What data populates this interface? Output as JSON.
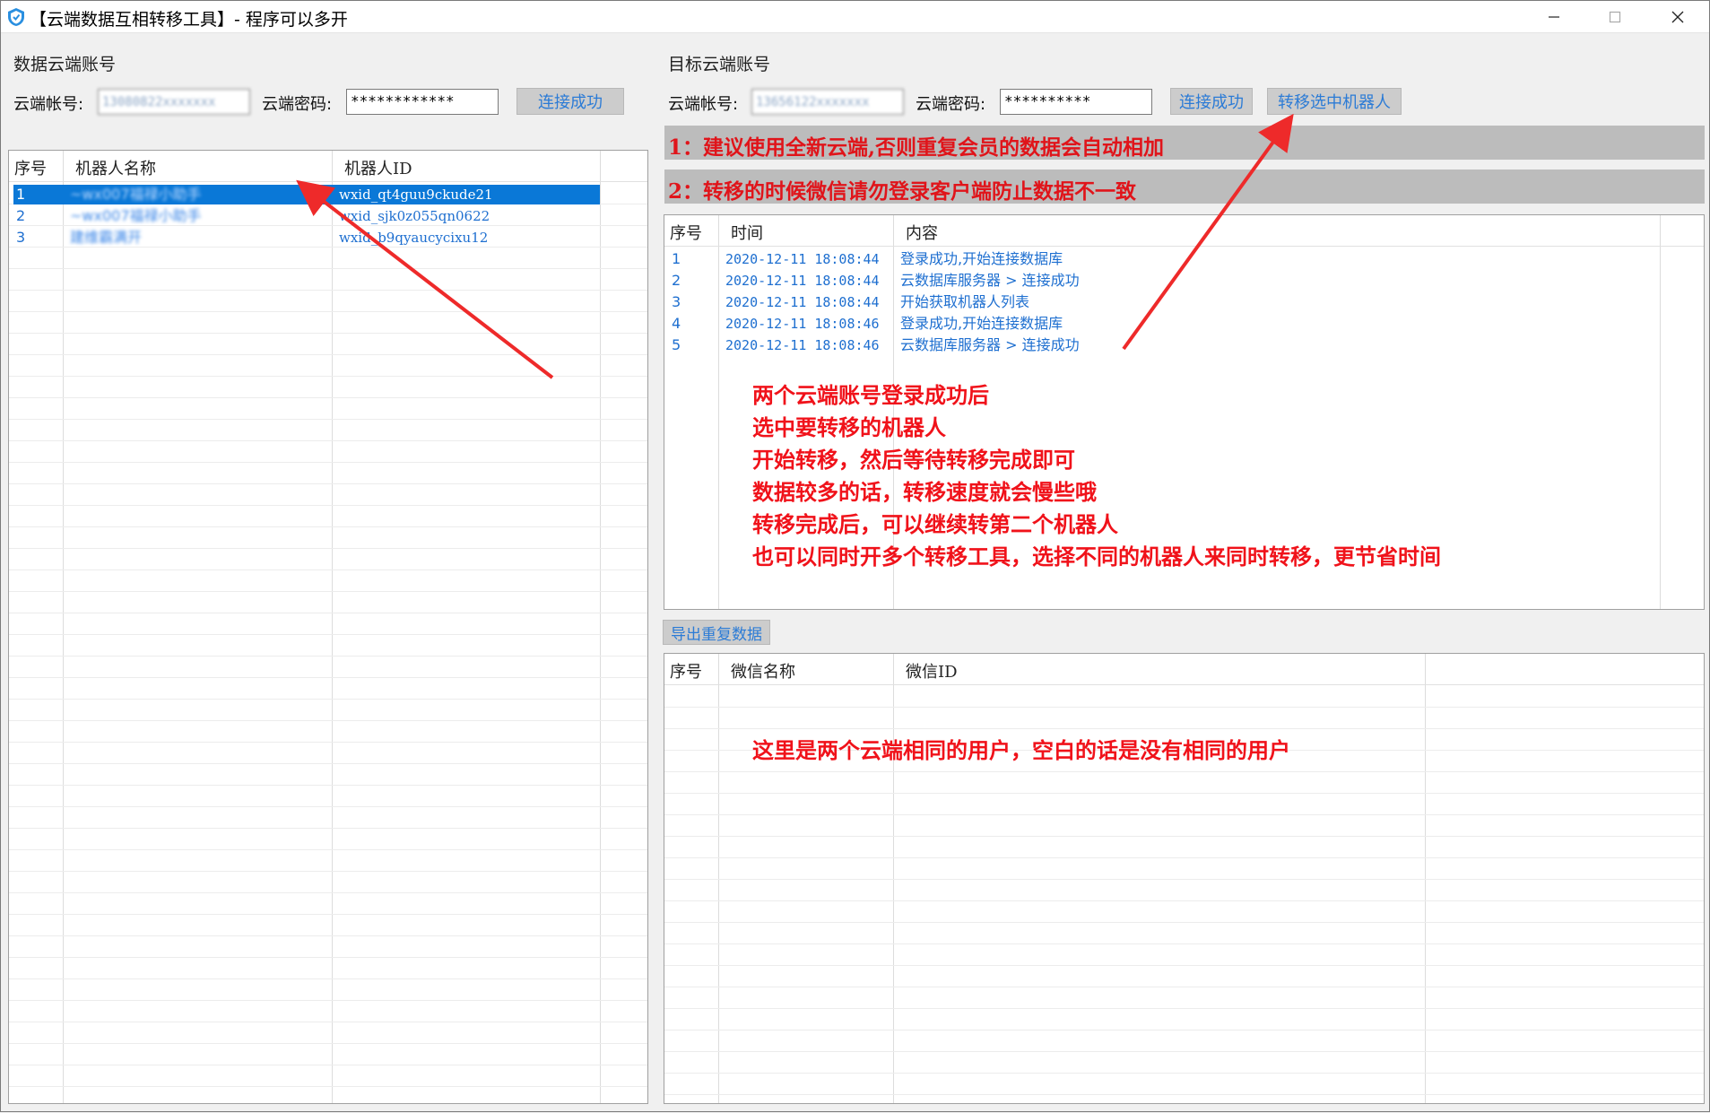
{
  "window": {
    "title": "【云端数据互相转移工具】- 程序可以多开"
  },
  "source": {
    "group_label": "数据云端账号",
    "account_label": "云端帐号:",
    "account_value": "13080822xxxxxxx",
    "password_label": "云端密码:",
    "password_value": "************",
    "connect_button": "连接成功",
    "table": {
      "headers": [
        "序号",
        "机器人名称",
        "机器人ID"
      ],
      "rows": [
        {
          "no": "1",
          "name": "~wx007福禄小助手",
          "id": "wxid_qt4guu9ckude21"
        },
        {
          "no": "2",
          "name": "~wx007福禄小助手",
          "id": "wxid_sjk0z055qn0622"
        },
        {
          "no": "3",
          "name": "建维霸满开",
          "id": "wxid_b9qyaucycixu12"
        }
      ]
    }
  },
  "target": {
    "group_label": "目标云端账号",
    "account_label": "云端帐号:",
    "account_value": "13656122xxxxxxx",
    "password_label": "云端密码:",
    "password_value": "**********",
    "connect_button": "连接成功",
    "transfer_button": "转移选中机器人",
    "notices": [
      "1：建议使用全新云端,否则重复会员的数据会自动相加",
      "2：转移的时候微信请勿登录客户端防止数据不一致"
    ],
    "log_table": {
      "headers": [
        "序号",
        "时间",
        "内容"
      ],
      "rows": [
        {
          "no": "1",
          "time": "2020-12-11 18:08:44",
          "content": "登录成功,开始连接数据库"
        },
        {
          "no": "2",
          "time": "2020-12-11 18:08:44",
          "content": "云数据库服务器 > 连接成功"
        },
        {
          "no": "3",
          "time": "2020-12-11 18:08:44",
          "content": "开始获取机器人列表"
        },
        {
          "no": "4",
          "time": "2020-12-11 18:08:46",
          "content": "登录成功,开始连接数据库"
        },
        {
          "no": "5",
          "time": "2020-12-11 18:08:46",
          "content": "云数据库服务器 > 连接成功"
        }
      ]
    },
    "export_button": "导出重复数据",
    "dup_table": {
      "headers": [
        "序号",
        "微信名称",
        "微信ID"
      ]
    }
  },
  "annotations": {
    "instructions": [
      "两个云端账号登录成功后",
      "选中要转移的机器人",
      "开始转移，然后等待转移完成即可",
      "数据较多的话，转移速度就会慢些哦",
      "转移完成后，可以继续转第二个机器人",
      "也可以同时开多个转移工具，选择不同的机器人来同时转移，更节省时间"
    ],
    "dup_note": "这里是两个云端相同的用户，空白的话是没有相同的用户"
  },
  "colors": {
    "accent": "#0a78d7",
    "link_text": "#1e6fd0",
    "annotation_red": "#f0121a",
    "notice_bg": "#bcbcbc"
  },
  "icons": [
    "app-shield-icon",
    "minimize-icon",
    "maximize-icon",
    "close-icon"
  ]
}
